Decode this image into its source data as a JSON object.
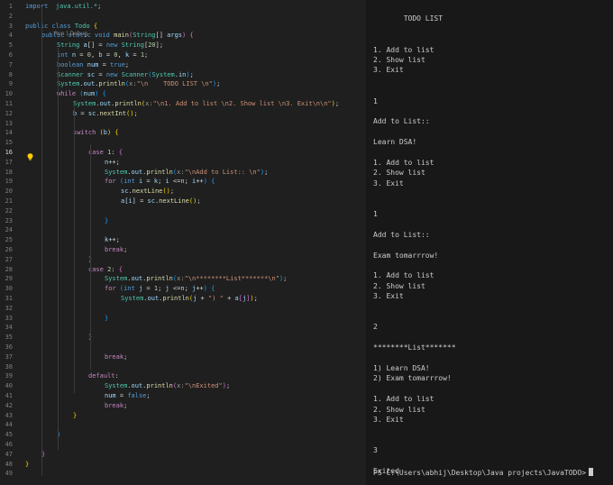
{
  "editor": {
    "lines": [
      {
        "n": "1",
        "t": [
          [
            "kw",
            "import"
          ],
          [
            "",
            "  "
          ],
          [
            "ty",
            "java.util.*"
          ],
          [
            "",
            ";"
          ]
        ]
      },
      {
        "n": "2",
        "t": []
      },
      {
        "n": "3",
        "t": [
          [
            "kw",
            "public"
          ],
          [
            "",
            " "
          ],
          [
            "kw",
            "class"
          ],
          [
            "",
            " "
          ],
          [
            "ty",
            "Todo"
          ],
          [
            "",
            " "
          ],
          [
            "b1",
            "{"
          ]
        ]
      },
      {
        "n": "4",
        "t": [
          [
            "",
            ""
          ],
          [
            "kw",
            "public"
          ],
          [
            "",
            " "
          ],
          [
            "kw",
            "static"
          ],
          [
            "",
            " "
          ],
          [
            "kw",
            "void"
          ],
          [
            "",
            " "
          ],
          [
            "fn",
            "main"
          ],
          [
            "b2",
            "("
          ],
          [
            "ty",
            "String"
          ],
          [
            "",
            "[] "
          ],
          [
            "var",
            "args"
          ],
          [
            "b2",
            ")"
          ],
          [
            "",
            " "
          ],
          [
            "b2",
            "{"
          ]
        ]
      },
      {
        "n": "5",
        "t": [
          [
            "ty",
            "String"
          ],
          [
            "",
            " "
          ],
          [
            "var",
            "a"
          ],
          [
            "",
            "[] = "
          ],
          [
            "kw",
            "new"
          ],
          [
            "",
            " "
          ],
          [
            "ty",
            "String"
          ],
          [
            "",
            "["
          ],
          [
            "num",
            "20"
          ],
          [
            "",
            "];"
          ]
        ]
      },
      {
        "n": "6",
        "t": [
          [
            "kw",
            "int"
          ],
          [
            "",
            " "
          ],
          [
            "var",
            "n"
          ],
          [
            "",
            " = "
          ],
          [
            "num",
            "0"
          ],
          [
            "",
            ", "
          ],
          [
            "var",
            "b"
          ],
          [
            "",
            " = "
          ],
          [
            "num",
            "0"
          ],
          [
            "",
            ", "
          ],
          [
            "var",
            "k"
          ],
          [
            "",
            " = "
          ],
          [
            "num",
            "1"
          ],
          [
            "",
            ";"
          ]
        ]
      },
      {
        "n": "7",
        "t": [
          [
            "kw",
            "boolean"
          ],
          [
            "",
            " "
          ],
          [
            "var",
            "num"
          ],
          [
            "",
            " = "
          ],
          [
            "kw",
            "true"
          ],
          [
            "",
            ";"
          ]
        ]
      },
      {
        "n": "8",
        "t": [
          [
            "ty",
            "Scanner"
          ],
          [
            "",
            " "
          ],
          [
            "var",
            "sc"
          ],
          [
            "",
            " = "
          ],
          [
            "kw",
            "new"
          ],
          [
            "",
            " "
          ],
          [
            "ty",
            "Scanner"
          ],
          [
            "b3",
            "("
          ],
          [
            "ty",
            "System"
          ],
          [
            "",
            "."
          ],
          [
            "var",
            "in"
          ],
          [
            "b3",
            ")"
          ],
          [
            "",
            ";"
          ]
        ]
      },
      {
        "n": "9",
        "t": [
          [
            "ty",
            "System"
          ],
          [
            "",
            "."
          ],
          [
            "var",
            "out"
          ],
          [
            "",
            "."
          ],
          [
            "fn",
            "println"
          ],
          [
            "b3",
            "("
          ],
          [
            "hint",
            "x:"
          ],
          [
            "str",
            "\"\\n    TODO LIST \\n\""
          ],
          [
            "b3",
            ")"
          ],
          [
            "",
            ";"
          ]
        ]
      },
      {
        "n": "10",
        "t": [
          [
            "ct",
            "while"
          ],
          [
            "",
            " "
          ],
          [
            "b3",
            "("
          ],
          [
            "var",
            "num"
          ],
          [
            "b3",
            ")"
          ],
          [
            "",
            " "
          ],
          [
            "b3",
            "{"
          ]
        ]
      },
      {
        "n": "11",
        "t": [
          [
            "ty",
            "System"
          ],
          [
            "",
            "."
          ],
          [
            "var",
            "out"
          ],
          [
            "",
            "."
          ],
          [
            "fn",
            "println"
          ],
          [
            "b1",
            "("
          ],
          [
            "hint",
            "x:"
          ],
          [
            "str",
            "\"\\n1. Add to list \\n2. Show list \\n3. Exit\\n\\n\""
          ],
          [
            "b1",
            ")"
          ],
          [
            "",
            ";"
          ]
        ]
      },
      {
        "n": "12",
        "t": [
          [
            "var",
            "b"
          ],
          [
            "",
            " = "
          ],
          [
            "var",
            "sc"
          ],
          [
            "",
            "."
          ],
          [
            "fn",
            "nextInt"
          ],
          [
            "b1",
            "()"
          ],
          [
            "",
            ";"
          ]
        ]
      },
      {
        "n": "13",
        "t": []
      },
      {
        "n": "14",
        "t": [
          [
            "ct",
            "switch"
          ],
          [
            "",
            " "
          ],
          [
            "b1",
            "("
          ],
          [
            "var",
            "b"
          ],
          [
            "b1",
            ")"
          ],
          [
            "",
            " "
          ],
          [
            "b1",
            "{"
          ]
        ]
      },
      {
        "n": "15",
        "t": []
      },
      {
        "n": "16",
        "t": [
          [
            "ct",
            "case"
          ],
          [
            "",
            " "
          ],
          [
            "num",
            "1"
          ],
          [
            "",
            ": "
          ],
          [
            "b2",
            "{"
          ]
        ]
      },
      {
        "n": "17",
        "t": [
          [
            "var",
            "n"
          ],
          [
            "",
            "++;"
          ]
        ]
      },
      {
        "n": "18",
        "t": [
          [
            "ty",
            "System"
          ],
          [
            "",
            "."
          ],
          [
            "var",
            "out"
          ],
          [
            "",
            "."
          ],
          [
            "fn",
            "println"
          ],
          [
            "b3",
            "("
          ],
          [
            "hint",
            "x:"
          ],
          [
            "str",
            "\"\\nAdd to List:: \\n\""
          ],
          [
            "b3",
            ")"
          ],
          [
            "",
            ";"
          ]
        ]
      },
      {
        "n": "19",
        "t": [
          [
            "ct",
            "for"
          ],
          [
            "",
            " "
          ],
          [
            "b3",
            "("
          ],
          [
            "kw",
            "int"
          ],
          [
            "",
            " "
          ],
          [
            "var",
            "i"
          ],
          [
            "",
            " = "
          ],
          [
            "var",
            "k"
          ],
          [
            "",
            "; "
          ],
          [
            "var",
            "i"
          ],
          [
            "",
            " <="
          ],
          [
            "var",
            "n"
          ],
          [
            "",
            "; "
          ],
          [
            "var",
            "i"
          ],
          [
            "",
            "++"
          ],
          [
            "b3",
            ")"
          ],
          [
            "",
            " "
          ],
          [
            "b3",
            "{"
          ]
        ]
      },
      {
        "n": "20",
        "t": [
          [
            "var",
            "sc"
          ],
          [
            "",
            "."
          ],
          [
            "fn",
            "nextLine"
          ],
          [
            "b1",
            "()"
          ],
          [
            "",
            ";"
          ]
        ]
      },
      {
        "n": "21",
        "t": [
          [
            "var",
            "a"
          ],
          [
            "",
            "["
          ],
          [
            "var",
            "i"
          ],
          [
            "",
            "] = "
          ],
          [
            "var",
            "sc"
          ],
          [
            "",
            "."
          ],
          [
            "fn",
            "nextLine"
          ],
          [
            "b1",
            "()"
          ],
          [
            "",
            ";"
          ]
        ]
      },
      {
        "n": "22",
        "t": []
      },
      {
        "n": "23",
        "t": [
          [
            "b3",
            "}"
          ]
        ]
      },
      {
        "n": "24",
        "t": []
      },
      {
        "n": "25",
        "t": [
          [
            "var",
            "k"
          ],
          [
            "",
            "++;"
          ]
        ]
      },
      {
        "n": "26",
        "t": [
          [
            "ct",
            "break"
          ],
          [
            "",
            ";"
          ]
        ]
      },
      {
        "n": "27",
        "t": [
          [
            "b2",
            "}"
          ]
        ]
      },
      {
        "n": "28",
        "t": [
          [
            "ct",
            "case"
          ],
          [
            "",
            " "
          ],
          [
            "num",
            "2"
          ],
          [
            "",
            ": "
          ],
          [
            "b2",
            "{"
          ]
        ]
      },
      {
        "n": "29",
        "t": [
          [
            "ty",
            "System"
          ],
          [
            "",
            "."
          ],
          [
            "var",
            "out"
          ],
          [
            "",
            "."
          ],
          [
            "fn",
            "println"
          ],
          [
            "b3",
            "("
          ],
          [
            "hint",
            "x:"
          ],
          [
            "str",
            "\"\\n********List*******\\n\""
          ],
          [
            "b3",
            ")"
          ],
          [
            "",
            ";"
          ]
        ]
      },
      {
        "n": "30",
        "t": [
          [
            "ct",
            "for"
          ],
          [
            "",
            " "
          ],
          [
            "b3",
            "("
          ],
          [
            "kw",
            "int"
          ],
          [
            "",
            " "
          ],
          [
            "var",
            "j"
          ],
          [
            "",
            " = "
          ],
          [
            "num",
            "1"
          ],
          [
            "",
            "; "
          ],
          [
            "var",
            "j"
          ],
          [
            "",
            " <="
          ],
          [
            "var",
            "n"
          ],
          [
            "",
            "; "
          ],
          [
            "var",
            "j"
          ],
          [
            "",
            "++"
          ],
          [
            "b3",
            ")"
          ],
          [
            "",
            " "
          ],
          [
            "b3",
            "{"
          ]
        ]
      },
      {
        "n": "31",
        "t": [
          [
            "ty",
            "System"
          ],
          [
            "",
            "."
          ],
          [
            "var",
            "out"
          ],
          [
            "",
            "."
          ],
          [
            "fn",
            "println"
          ],
          [
            "b1",
            "("
          ],
          [
            "var",
            "j"
          ],
          [
            "",
            " + "
          ],
          [
            "str",
            "\") \""
          ],
          [
            "",
            " + "
          ],
          [
            "var",
            "a"
          ],
          [
            "b2",
            "["
          ],
          [
            "var",
            "j"
          ],
          [
            "b2",
            "]"
          ],
          [
            "b1",
            ")"
          ],
          [
            "",
            ";"
          ]
        ]
      },
      {
        "n": "32",
        "t": []
      },
      {
        "n": "33",
        "t": [
          [
            "b3",
            "}"
          ]
        ]
      },
      {
        "n": "34",
        "t": []
      },
      {
        "n": "35",
        "t": [
          [
            "b2",
            "}"
          ]
        ]
      },
      {
        "n": "36",
        "t": []
      },
      {
        "n": "37",
        "t": [
          [
            "ct",
            "break"
          ],
          [
            "",
            ";"
          ]
        ]
      },
      {
        "n": "38",
        "t": []
      },
      {
        "n": "39",
        "t": [
          [
            "ct",
            "default"
          ],
          [
            "",
            ":"
          ]
        ]
      },
      {
        "n": "40",
        "t": [
          [
            "ty",
            "System"
          ],
          [
            "",
            "."
          ],
          [
            "var",
            "out"
          ],
          [
            "",
            "."
          ],
          [
            "fn",
            "println"
          ],
          [
            "b2",
            "("
          ],
          [
            "hint",
            "x:"
          ],
          [
            "str",
            "\"\\nExited\""
          ],
          [
            "b2",
            ")"
          ],
          [
            "",
            ";"
          ]
        ]
      },
      {
        "n": "41",
        "t": [
          [
            "var",
            "num"
          ],
          [
            "",
            " = "
          ],
          [
            "kw",
            "false"
          ],
          [
            "",
            ";"
          ]
        ]
      },
      {
        "n": "42",
        "t": [
          [
            "ct",
            "break"
          ],
          [
            "",
            ";"
          ]
        ]
      },
      {
        "n": "43",
        "t": [
          [
            "b1",
            "}"
          ]
        ]
      },
      {
        "n": "44",
        "t": []
      },
      {
        "n": "45",
        "t": [
          [
            "b3",
            "}"
          ]
        ]
      },
      {
        "n": "46",
        "t": []
      },
      {
        "n": "47",
        "t": [
          [
            "b2",
            "}"
          ]
        ]
      },
      {
        "n": "48",
        "t": [
          [
            "b1",
            "}"
          ]
        ]
      },
      {
        "n": "49",
        "t": []
      }
    ],
    "codelens": "Run | Debug",
    "current_line": "16"
  },
  "terminal": {
    "lines": [
      "",
      "       TODO LIST",
      "",
      "",
      "1. Add to list",
      "2. Show list",
      "3. Exit",
      "",
      "",
      "1",
      "",
      "Add to List::",
      "",
      "Learn DSA!",
      "",
      "1. Add to list",
      "2. Show list",
      "3. Exit",
      "",
      "",
      "1",
      "",
      "Add to List::",
      "",
      "Exam tomarrrow!",
      "",
      "1. Add to list",
      "2. Show list",
      "3. Exit",
      "",
      "",
      "2",
      "",
      "********List*******",
      "",
      "1) Learn DSA!",
      "2) Exam tomarrrow!",
      "",
      "1. Add to list",
      "2. Show list",
      "3. Exit",
      "",
      "",
      "3",
      "",
      "Exited"
    ],
    "prompt": "PS C:\\Users\\abhij\\Desktop\\Java projects\\JavaTODO>"
  },
  "colors": {
    "editor_bg": "#1f1f1f",
    "terminal_bg": "#181818",
    "keyword": "#569cd6",
    "control": "#c586c0",
    "type": "#4ec9b0",
    "function": "#dcdcaa",
    "string": "#ce9178",
    "variable": "#9cdcfe",
    "number": "#b5cea8"
  },
  "icons": {
    "lightbulb": "lightbulb-icon"
  }
}
